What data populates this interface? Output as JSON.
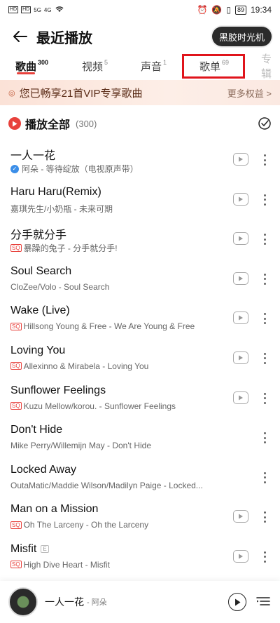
{
  "status_bar": {
    "left": [
      "HD",
      "HD",
      "5G",
      "4G"
    ],
    "battery": "89",
    "time": "19:34"
  },
  "header": {
    "title": "最近播放",
    "time_machine": "黑胶时光机"
  },
  "tabs": [
    {
      "label": "歌曲",
      "count": "300",
      "active": true
    },
    {
      "label": "视频",
      "count": "5"
    },
    {
      "label": "声音",
      "count": "1"
    },
    {
      "label": "歌单",
      "count": "69"
    },
    {
      "label": "专辑",
      "count": ""
    }
  ],
  "vip_banner": {
    "text": "您已畅享21首VIP专享歌曲",
    "more": "更多权益 >"
  },
  "play_all": {
    "label": "播放全部",
    "count": "(300)"
  },
  "songs": [
    {
      "title": "一人一花",
      "sub": "阿朵 - 等待绽放（电视原声带）",
      "badge": "verified"
    },
    {
      "title": "Haru Haru(Remix)",
      "sub": "嘉琪先生/小奶瓶 - 未来可期",
      "badge": ""
    },
    {
      "title": "分手就分手",
      "sub": "暴躁的兔子 - 分手就分手!",
      "badge": "SQ"
    },
    {
      "title": "Soul Search",
      "sub": "CloZee/Volo - Soul Search",
      "badge": ""
    },
    {
      "title": "Wake (Live)",
      "sub": "Hillsong Young & Free - We Are Young & Free",
      "badge": "SQ"
    },
    {
      "title": "Loving You",
      "sub": "Allexinno & Mirabela - Loving You",
      "badge": "SQ"
    },
    {
      "title": "Sunflower Feelings",
      "sub": "Kuzu Mellow/korou. - Sunflower Feelings",
      "badge": "SQ"
    },
    {
      "title": "Don't Hide",
      "sub": "Mike Perry/Willemijn May - Don't Hide",
      "badge": ""
    },
    {
      "title": "Locked Away",
      "sub": "OutaMatic/Maddie Wilson/Madilyn Paige - Locked...",
      "badge": ""
    },
    {
      "title": "Man on a Mission",
      "sub": "Oh The Larceny - Oh the Larceny",
      "badge": "SQ"
    },
    {
      "title": "Misfit",
      "sub": "High Dive Heart - Misfit",
      "badge": "SQ",
      "explicit": "E"
    }
  ],
  "player": {
    "title": "一人一花",
    "artist": "- 阿朵"
  },
  "colors": {
    "accent": "#e8413c",
    "highlight_box": "#e0141b"
  }
}
